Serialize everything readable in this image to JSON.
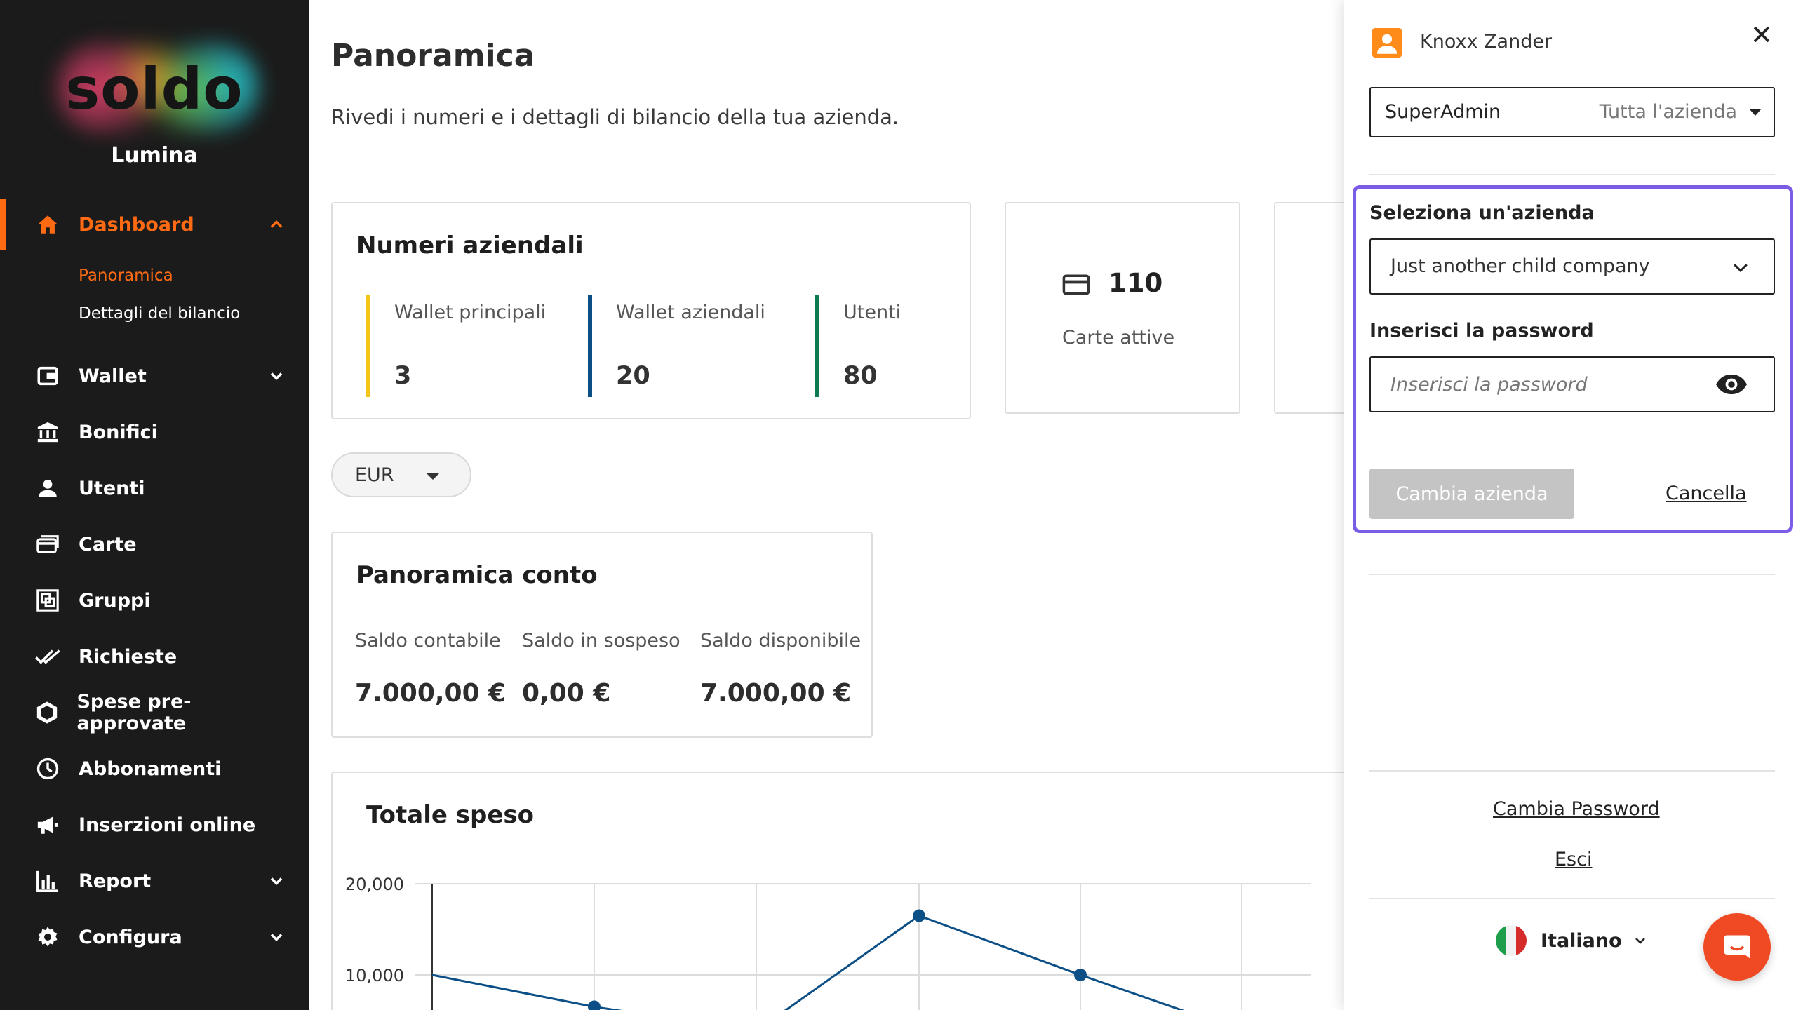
{
  "app": {
    "logo": "soldo",
    "company": "Lumina"
  },
  "sidebar": {
    "items": [
      {
        "label": "Dashboard",
        "icon": "home-icon",
        "active": true,
        "expandable": true
      },
      {
        "label": "Wallet",
        "icon": "wallet-icon",
        "expandable": true
      },
      {
        "label": "Bonifici",
        "icon": "bank-icon"
      },
      {
        "label": "Utenti",
        "icon": "user-icon"
      },
      {
        "label": "Carte",
        "icon": "cards-icon"
      },
      {
        "label": "Gruppi",
        "icon": "groups-icon"
      },
      {
        "label": "Richieste",
        "icon": "double-check-icon"
      },
      {
        "label": "Spese pre-approvate",
        "icon": "hexagon-icon"
      },
      {
        "label": "Abbonamenti",
        "icon": "clock-icon"
      },
      {
        "label": "Inserzioni online",
        "icon": "megaphone-icon"
      },
      {
        "label": "Report",
        "icon": "bar-chart-icon",
        "expandable": true
      },
      {
        "label": "Configura",
        "icon": "gear-icon",
        "expandable": true
      }
    ],
    "dashboard_sub": [
      {
        "label": "Panoramica",
        "active": true
      },
      {
        "label": "Dettagli del bilancio"
      }
    ]
  },
  "main": {
    "title": "Panoramica",
    "subtitle": "Rivedi i numeri e i dettagli di bilancio della tua azienda.",
    "numbers_card": {
      "title": "Numeri aziendali",
      "metrics": [
        {
          "label": "Wallet principali",
          "value": "3",
          "color": "#f5c518"
        },
        {
          "label": "Wallet aziendali",
          "value": "20",
          "color": "#0b4f86"
        },
        {
          "label": "Utenti",
          "value": "80",
          "color": "#0e7a52"
        }
      ]
    },
    "cards_card": {
      "value": "110",
      "label": "Carte attive",
      "icon": "credit-card-icon"
    },
    "currency": "EUR",
    "account_card": {
      "title": "Panoramica conto",
      "items": [
        {
          "label": "Saldo contabile",
          "value": "7.000,00 €"
        },
        {
          "label": "Saldo in sospeso",
          "value": "0,00 €"
        },
        {
          "label": "Saldo disponibile",
          "value": "7.000,00 €"
        }
      ]
    },
    "spend_card": {
      "title": "Totale speso"
    }
  },
  "chart_data": {
    "type": "line",
    "title": "Totale speso",
    "yticks": [
      "20,000",
      "10,000"
    ],
    "ylim": [
      0,
      20000
    ],
    "series": [
      {
        "points": [
          10000,
          6500,
          16500,
          10000
        ],
        "color": "#0b4f86"
      }
    ],
    "grid": true
  },
  "panel": {
    "user_name": "Knoxx Zander",
    "role": "SuperAdmin",
    "scope": "Tutta l'azienda",
    "select_company_label": "Seleziona un'azienda",
    "selected_company": "Just another child company",
    "password_label": "Inserisci la password",
    "password_placeholder": "Inserisci la password",
    "switch_button": "Cambia azienda",
    "cancel_link": "Cancella",
    "change_password_link": "Cambia Password",
    "logout_link": "Esci",
    "language": "Italiano",
    "accent_color": "#7b5ce6"
  }
}
